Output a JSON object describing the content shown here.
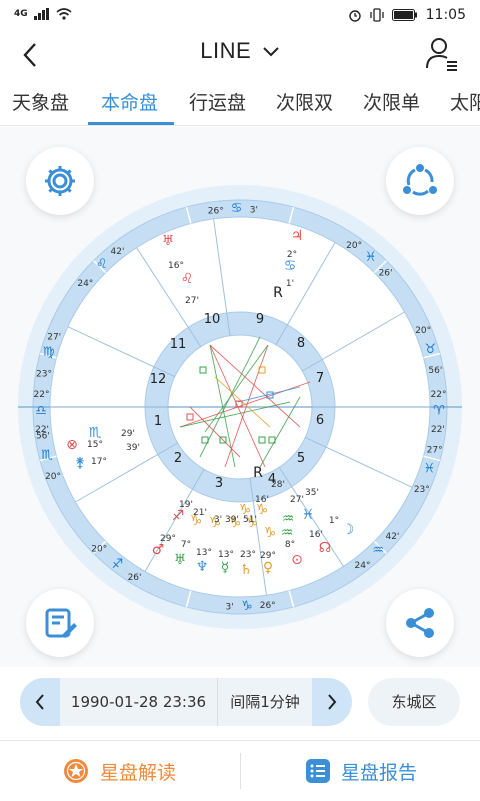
{
  "status_bar": {
    "network": "4G",
    "time": "11:05"
  },
  "nav": {
    "title": "LINE"
  },
  "tabs": [
    {
      "label": "天象盘"
    },
    {
      "label": "本命盘"
    },
    {
      "label": "行运盘"
    },
    {
      "label": "次限双"
    },
    {
      "label": "次限单"
    },
    {
      "label": "太阳"
    }
  ],
  "wheel": {
    "houses": [
      "1",
      "2",
      "3",
      "4",
      "5",
      "6",
      "7",
      "8",
      "9",
      "10",
      "11",
      "12"
    ],
    "outer_labels": [
      {
        "text": "26°",
        "a": -100
      },
      {
        "text": "♋",
        "a": -95
      },
      {
        "text": "3'",
        "a": -90
      },
      {
        "text": "20°",
        "a": -60
      },
      {
        "text": "♓",
        "a": -54
      },
      {
        "text": "26'",
        "a": -48
      },
      {
        "text": "20°",
        "a": -22
      },
      {
        "text": "♉",
        "a": -16
      },
      {
        "text": "56'",
        "a": -10
      },
      {
        "text": "22°",
        "a": 4
      },
      {
        "text": "♈",
        "a": 0
      },
      {
        "text": "22'",
        "a": -4
      },
      {
        "text": "27'",
        "a": -28
      },
      {
        "text": "♊",
        "a": -34
      },
      {
        "text": "27°",
        "a": -40
      },
      {
        "text": "42'",
        "a": -133
      },
      {
        "text": "♌",
        "a": -126
      },
      {
        "text": "24°",
        "a": -140
      },
      {
        "text": "27'",
        "a": -168
      },
      {
        "text": "♍",
        "a": -162
      },
      {
        "text": "23°",
        "a": -156
      },
      {
        "text": "22°",
        "a": 176
      },
      {
        "text": "♎",
        "a": 180
      },
      {
        "text": "22'",
        "a": 184
      }
    ],
    "planet_labels": [
      "16°",
      "27'",
      "2°",
      "1'",
      "R",
      "15°",
      "17°",
      "29'",
      "39'",
      "19'",
      "21'",
      "3'",
      "39'",
      "51'",
      "16'",
      "28'",
      "27'",
      "35'",
      "1°",
      "29°",
      "7°",
      "13°",
      "13°",
      "23°",
      "29°",
      "8°",
      "16'",
      "R"
    ],
    "bottom_labels": [
      "20°",
      "56'",
      "42'",
      "24°",
      "26°",
      "3'",
      "26'",
      "27'",
      "23°",
      "20°"
    ]
  },
  "controls": {
    "datetime": "1990-01-28 23:36",
    "interval": "间隔1分钟",
    "city": "东城区"
  },
  "footer": {
    "left_label": "星盘解读",
    "right_label": "星盘报告"
  },
  "colors": {
    "accent": "#3a8fd6",
    "ring": "#c5def3",
    "ring_light": "#e3eff9",
    "orange": "#f08a3e"
  }
}
